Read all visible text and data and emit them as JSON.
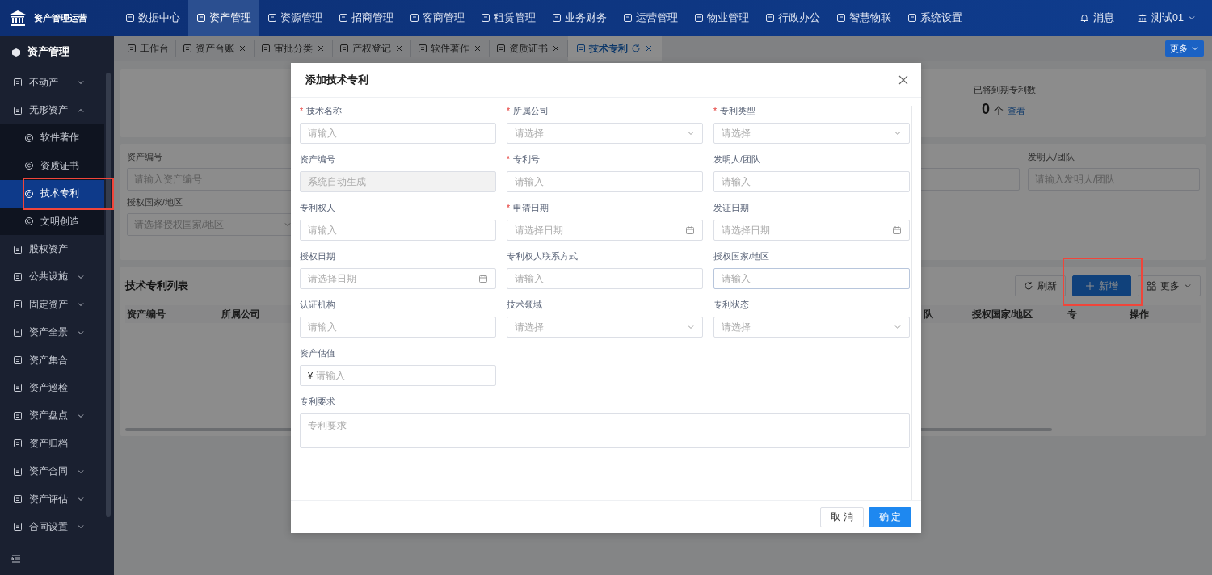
{
  "top_nav": {
    "logo_text": "资产管理运营",
    "items": [
      {
        "label": "数据中心",
        "selected": false
      },
      {
        "label": "资产管理",
        "selected": true
      },
      {
        "label": "资源管理",
        "selected": false
      },
      {
        "label": "招商管理",
        "selected": false
      },
      {
        "label": "客商管理",
        "selected": false
      },
      {
        "label": "租赁管理",
        "selected": false
      },
      {
        "label": "业务财务",
        "selected": false
      },
      {
        "label": "运营管理",
        "selected": false
      },
      {
        "label": "物业管理",
        "selected": false
      },
      {
        "label": "行政办公",
        "selected": false
      },
      {
        "label": "智慧物联",
        "selected": false
      },
      {
        "label": "系统设置",
        "selected": false
      }
    ],
    "messages": "消息",
    "user": "测试01"
  },
  "sidebar": {
    "title": "资产管理",
    "items": [
      {
        "label": "不动产",
        "expanded": false
      },
      {
        "label": "无形资产",
        "expanded": true,
        "children": [
          {
            "label": "软件著作",
            "selected": false,
            "highlighted": false
          },
          {
            "label": "资质证书",
            "selected": false,
            "highlighted": false
          },
          {
            "label": "技术专利",
            "selected": true,
            "highlighted": true
          },
          {
            "label": "文明创造",
            "selected": false,
            "highlighted": false
          }
        ]
      },
      {
        "label": "股权资产"
      },
      {
        "label": "公共设施",
        "expanded": false
      },
      {
        "label": "固定资产",
        "expanded": false
      },
      {
        "label": "资产全景",
        "expanded": false
      },
      {
        "label": "资产集合"
      },
      {
        "label": "资产巡检"
      },
      {
        "label": "资产盘点",
        "expanded": false
      },
      {
        "label": "资产归档"
      },
      {
        "label": "资产合同",
        "expanded": false
      },
      {
        "label": "资产评估",
        "expanded": false
      },
      {
        "label": "合同设置",
        "expanded": false
      }
    ]
  },
  "tabs": [
    {
      "label": "工作台",
      "selected": false,
      "closable": false
    },
    {
      "label": "资产台账",
      "selected": false,
      "closable": true
    },
    {
      "label": "审批分类",
      "selected": false,
      "closable": true
    },
    {
      "label": "产权登记",
      "selected": false,
      "closable": true
    },
    {
      "label": "软件著作",
      "selected": false,
      "closable": true
    },
    {
      "label": "资质证书",
      "selected": false,
      "closable": true
    },
    {
      "label": "技术专利",
      "selected": true,
      "closable": true
    }
  ],
  "tabs_more": "更多",
  "stats": {
    "label": "已将到期专利数",
    "value": "0",
    "unit": "个",
    "link": "查看"
  },
  "filters": [
    {
      "label": "资产编号",
      "placeholder": "请输入资产编号",
      "kind": "input"
    },
    {
      "kind": "input"
    },
    {
      "label": "发明人/团队",
      "placeholder": "请输入发明人/团队",
      "kind": "input"
    },
    {
      "label": "授权国家/地区",
      "placeholder": "请选择授权国家/地区",
      "kind": "select"
    }
  ],
  "list": {
    "title": "技术专利列表",
    "buttons": [
      {
        "label": "刷新",
        "kind": "refresh",
        "highlighted": false
      },
      {
        "label": "新增",
        "kind": "add",
        "highlighted": true
      },
      {
        "label": "更多",
        "kind": "more",
        "highlighted": false
      }
    ],
    "columns": [
      "资产编号",
      "所属公司",
      "队",
      "授权国家/地区",
      "专",
      "操作"
    ]
  },
  "modal": {
    "title": "添加技术专利",
    "required_mark": "*",
    "fields": [
      {
        "label": "技术名称",
        "required": true,
        "kind": "input",
        "placeholder": "请输入"
      },
      {
        "label": "所属公司",
        "required": true,
        "kind": "select",
        "placeholder": "请选择"
      },
      {
        "label": "专利类型",
        "required": true,
        "kind": "select",
        "placeholder": "请选择"
      },
      {
        "label": "资产编号",
        "required": false,
        "kind": "input",
        "placeholder": "系统自动生成",
        "disabled": true
      },
      {
        "label": "专利号",
        "required": true,
        "kind": "input",
        "placeholder": "请输入"
      },
      {
        "label": "发明人/团队",
        "required": false,
        "kind": "input",
        "placeholder": "请输入"
      },
      {
        "label": "专利权人",
        "required": false,
        "kind": "input",
        "placeholder": "请输入"
      },
      {
        "label": "申请日期",
        "required": true,
        "kind": "date",
        "placeholder": "请选择日期"
      },
      {
        "label": "发证日期",
        "required": false,
        "kind": "date",
        "placeholder": "请选择日期"
      },
      {
        "label": "授权日期",
        "required": false,
        "kind": "date",
        "placeholder": "请选择日期"
      },
      {
        "label": "专利权人联系方式",
        "required": false,
        "kind": "input",
        "placeholder": "请输入"
      },
      {
        "label": "授权国家/地区",
        "required": false,
        "kind": "input",
        "placeholder": "请输入",
        "focused": true
      },
      {
        "label": "认证机构",
        "required": false,
        "kind": "input",
        "placeholder": "请输入"
      },
      {
        "label": "技术领域",
        "required": false,
        "kind": "select",
        "placeholder": "请选择"
      },
      {
        "label": "专利状态",
        "required": false,
        "kind": "select",
        "placeholder": "请选择"
      },
      {
        "label": "资产估值",
        "required": false,
        "kind": "money",
        "prefix": "¥",
        "placeholder": "请输入"
      },
      {
        "label": "专利要求",
        "required": false,
        "kind": "textarea",
        "placeholder": "专利要求"
      }
    ],
    "buttons": [
      {
        "label": "取 消",
        "kind": "secondary"
      },
      {
        "label": "确 定",
        "kind": "primary"
      }
    ]
  }
}
